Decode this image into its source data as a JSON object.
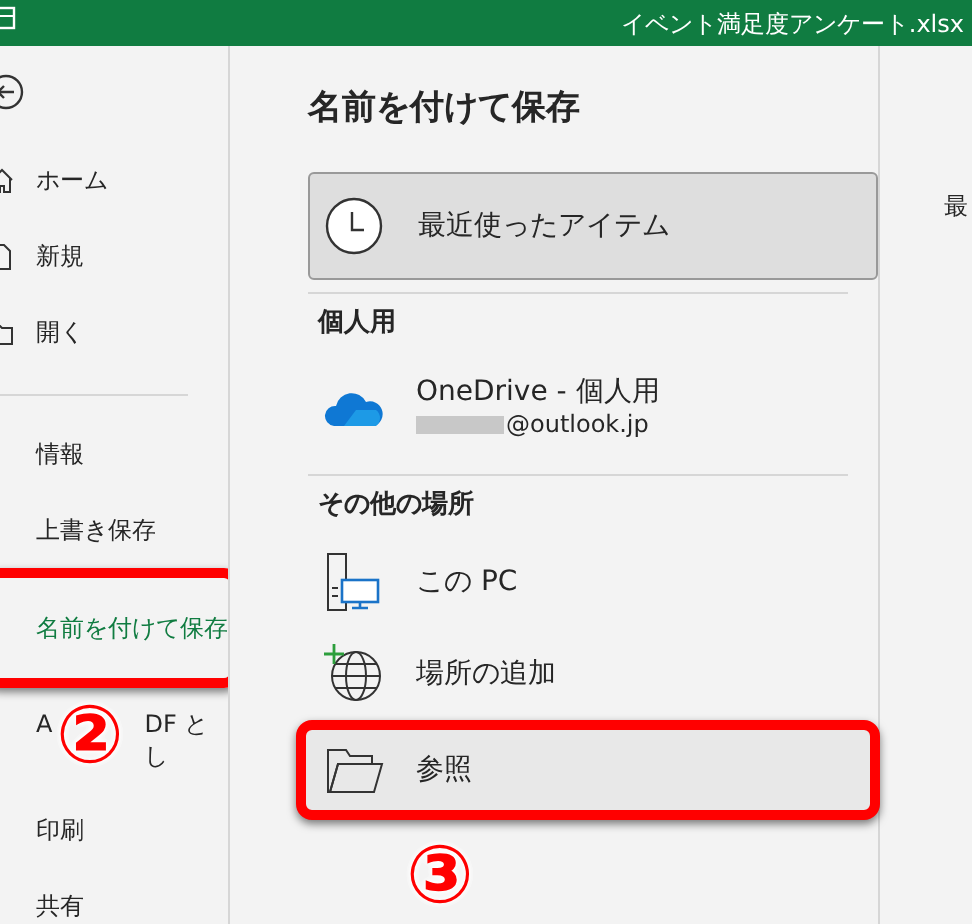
{
  "window": {
    "title": "イベント満足度アンケート.xlsx"
  },
  "sidebar": {
    "items": [
      {
        "label": "ホーム",
        "kind": "home",
        "selected": false,
        "highlighted": false
      },
      {
        "label": "新規",
        "kind": "new",
        "selected": false,
        "highlighted": false
      },
      {
        "label": "開く",
        "kind": "open",
        "selected": false,
        "highlighted": false
      },
      {
        "kind": "divider"
      },
      {
        "label": "情報",
        "selected": false,
        "highlighted": false
      },
      {
        "label": "上書き保存",
        "selected": false,
        "highlighted": false
      },
      {
        "label": "名前を付けて保存",
        "selected": true,
        "highlighted": true
      },
      {
        "label_parts": [
          "A",
          "DF とし"
        ],
        "selected": false,
        "highlighted": false,
        "callout": "②"
      },
      {
        "label": "印刷",
        "selected": false,
        "highlighted": false
      },
      {
        "label": "共有",
        "selected": false,
        "highlighted": false
      }
    ]
  },
  "main": {
    "heading": "名前を付けて保存",
    "recent": {
      "label": "最近使ったアイテム",
      "selected": true
    },
    "groups": [
      {
        "title": "個人用",
        "locations": [
          {
            "kind": "onedrive",
            "label": "OneDrive - 個人用",
            "account": "@outlook.jp",
            "account_redacted": true,
            "highlighted": false
          }
        ]
      },
      {
        "title": "その他の場所",
        "locations": [
          {
            "kind": "pc",
            "label": "この PC",
            "highlighted": false
          },
          {
            "kind": "add",
            "label": "場所の追加",
            "highlighted": false
          },
          {
            "kind": "browse",
            "label": "参照",
            "highlighted": true,
            "callout": "③"
          }
        ]
      }
    ]
  },
  "right_panel": {
    "text": "最"
  }
}
